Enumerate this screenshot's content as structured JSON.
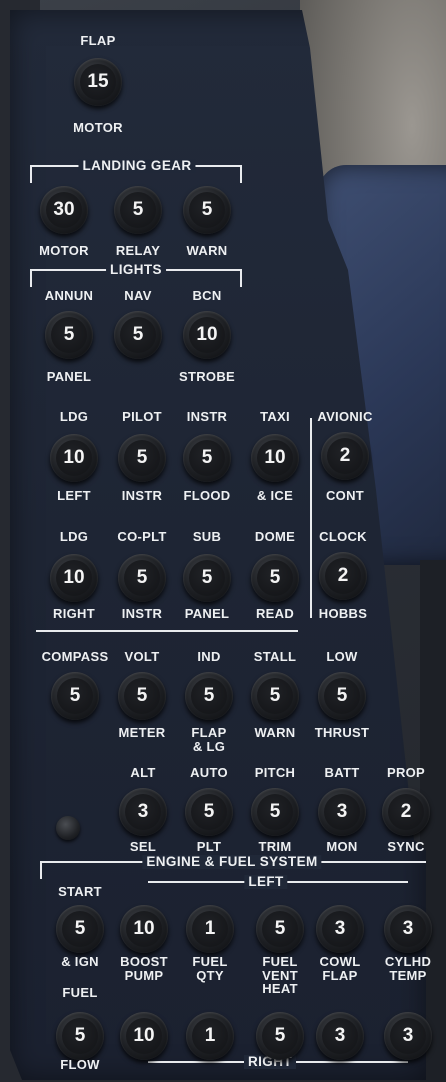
{
  "flap": {
    "title": "FLAP",
    "breaker": "15",
    "label": "MOTOR"
  },
  "landing_gear": {
    "title": "LANDING GEAR",
    "breakers": [
      {
        "value": "30",
        "label": "MOTOR"
      },
      {
        "value": "5",
        "label": "RELAY"
      },
      {
        "value": "5",
        "label": "WARN"
      }
    ]
  },
  "lights": {
    "title": "LIGHTS",
    "row1": [
      {
        "top": "ANNUN",
        "value": "5",
        "bottom": "PANEL"
      },
      {
        "top": "NAV",
        "value": "5",
        "bottom": ""
      },
      {
        "top": "BCN",
        "value": "10",
        "bottom": "STROBE"
      }
    ],
    "row2": [
      {
        "top": "LDG",
        "value": "10",
        "bottom": "LEFT"
      },
      {
        "top": "PILOT",
        "value": "5",
        "bottom": "INSTR"
      },
      {
        "top": "INSTR",
        "value": "5",
        "bottom": "FLOOD"
      },
      {
        "top": "TAXI",
        "value": "10",
        "bottom": "& ICE"
      }
    ],
    "row3": [
      {
        "top": "LDG",
        "value": "10",
        "bottom": "RIGHT"
      },
      {
        "top": "CO-PLT",
        "value": "5",
        "bottom": "INSTR"
      },
      {
        "top": "SUB",
        "value": "5",
        "bottom": "PANEL"
      },
      {
        "top": "DOME",
        "value": "5",
        "bottom": "READ"
      }
    ]
  },
  "avionics": [
    {
      "top": "AVIONIC",
      "value": "2",
      "bottom": "CONT"
    },
    {
      "top": "CLOCK",
      "value": "2",
      "bottom": "HOBBS"
    }
  ],
  "instruments": [
    {
      "top": "COMPASS",
      "value": "5",
      "bottom": ""
    },
    {
      "top": "VOLT",
      "value": "5",
      "bottom": "METER"
    },
    {
      "top": "IND",
      "value": "5",
      "bottom": "FLAP\n& LG"
    },
    {
      "top": "STALL",
      "value": "5",
      "bottom": "WARN"
    },
    {
      "top": "LOW",
      "value": "5",
      "bottom": "THRUST"
    }
  ],
  "systems": [
    {
      "top": "ALT",
      "value": "3",
      "bottom": "SEL"
    },
    {
      "top": "AUTO",
      "value": "5",
      "bottom": "PLT"
    },
    {
      "top": "PITCH",
      "value": "5",
      "bottom": "TRIM"
    },
    {
      "top": "BATT",
      "value": "3",
      "bottom": "MON"
    },
    {
      "top": "PROP",
      "value": "2",
      "bottom": "SYNC"
    }
  ],
  "engine_fuel": {
    "title": "ENGINE & FUEL SYSTEM",
    "left_label": "LEFT",
    "right_label": "RIGHT",
    "row1": [
      {
        "top": "START",
        "value": "5",
        "bottom": "& IGN"
      },
      {
        "top": "",
        "value": "10",
        "bottom": "BOOST\nPUMP"
      },
      {
        "top": "",
        "value": "1",
        "bottom": "FUEL\nQTY"
      },
      {
        "top": "",
        "value": "5",
        "bottom": "FUEL\nVENT\nHEAT"
      },
      {
        "top": "",
        "value": "3",
        "bottom": "COWL\nFLAP"
      },
      {
        "top": "",
        "value": "3",
        "bottom": "CYLHD\nTEMP"
      }
    ],
    "row2": [
      {
        "top": "FUEL",
        "value": "5",
        "bottom": "FLOW"
      },
      {
        "top": "",
        "value": "10",
        "bottom": ""
      },
      {
        "top": "",
        "value": "1",
        "bottom": ""
      },
      {
        "top": "",
        "value": "5",
        "bottom": ""
      },
      {
        "top": "",
        "value": "3",
        "bottom": ""
      },
      {
        "top": "",
        "value": "3",
        "bottom": ""
      }
    ]
  },
  "colors": {
    "panel": "#1f2636",
    "text": "#eef0f2",
    "breaker": "#15171b"
  },
  "icons": {
    "breaker": "circuit-breaker-icon",
    "knob": "knob-icon"
  }
}
